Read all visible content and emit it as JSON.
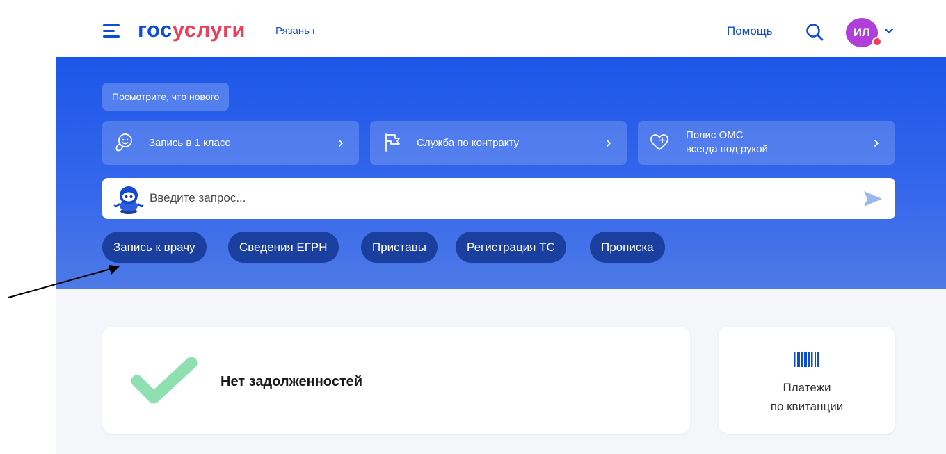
{
  "header": {
    "logo_part1": "гос",
    "logo_part2": "услуги",
    "region": "Рязань г",
    "help": "Помощь",
    "avatar_initials": "ИЛ"
  },
  "hero": {
    "whats_new": "Посмотрите, что нового",
    "promos": [
      {
        "label": "Запись в 1 класс",
        "icon": "child-smile-icon"
      },
      {
        "label": "Служба по контракту",
        "icon": "flag-icon"
      },
      {
        "label_line1": "Полис ОМС",
        "label_line2": "всегда под рукой",
        "icon": "heart-plus-icon"
      }
    ],
    "search": {
      "placeholder": "Введите запрос...",
      "value": ""
    },
    "chips": [
      "Запись к врачу",
      "Сведения ЕГРН",
      "Приставы",
      "Регистрация ТС",
      "Прописка"
    ]
  },
  "cards": {
    "debt": {
      "text": "Нет задолженностей",
      "icon": "checkmark-icon"
    },
    "payments": {
      "line1": "Платежи",
      "line2": "по квитанции",
      "icon": "barcode-icon"
    }
  },
  "colors": {
    "brand_blue": "#0d4cd3",
    "brand_red": "#ee3f58",
    "hero_blue": "#1c56e8",
    "chip_bg": "#1a3f9f",
    "avatar_bg": "#b03fd9",
    "check_green": "#8fe0b0"
  }
}
